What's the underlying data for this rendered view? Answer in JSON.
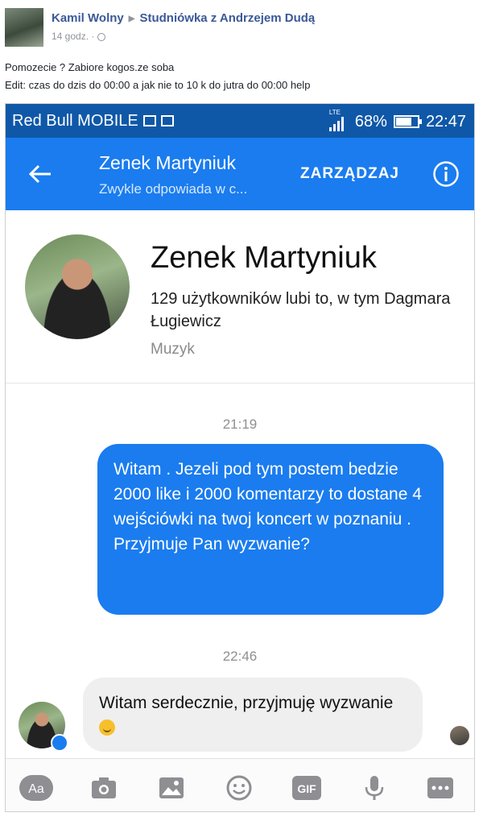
{
  "post": {
    "author": "Kamil Wolny",
    "group": "Studniówka z Andrzejem Dudą",
    "time": "14 godz. ·",
    "text_line1": "Pomozecie ? Zabiore kogos.ze soba",
    "text_line2": "Edit: czas do dzis do 00:00 a jak nie to 10 k do jutra do 00:00 help"
  },
  "status_bar": {
    "carrier": "Red Bull MOBILE",
    "network": "LTE",
    "battery": "68%",
    "battery_level": 0.68,
    "time": "22:47"
  },
  "app_bar": {
    "contact_name": "Zenek Martyniuk",
    "subtitle": "Zwykle odpowiada w c...",
    "manage_label": "ZARZĄDZAJ"
  },
  "profile": {
    "name": "Zenek Martyniuk",
    "likes": "129 użytkowników lubi to, w tym Dagmara Ługiewicz",
    "category": "Muzyk"
  },
  "messages": [
    {
      "timestamp": "21:19",
      "direction": "outgoing",
      "text": "Witam . Jezeli pod tym postem bedzie 2000 like i 2000 komentarzy to dostane 4 wejściówki na twoj koncert w poznaniu . Przyjmuje Pan wyzwanie?"
    },
    {
      "timestamp": "22:46",
      "direction": "incoming",
      "text": "Witam serdecznie, przyjmuję wyzwanie",
      "emoji": "smiling-face"
    }
  ],
  "composer": {
    "aa_label": "Aa",
    "gif_label": "GIF",
    "icons": [
      "aa-icon",
      "camera-icon",
      "image-icon",
      "emoji-icon",
      "gif-icon",
      "microphone-icon",
      "more-icon"
    ]
  },
  "colors": {
    "status_bar": "#0f58a8",
    "app_bar": "#1a7cef",
    "outgoing_bubble": "#1a7cef",
    "incoming_bubble": "#efefef",
    "fb_link": "#3b5998"
  }
}
